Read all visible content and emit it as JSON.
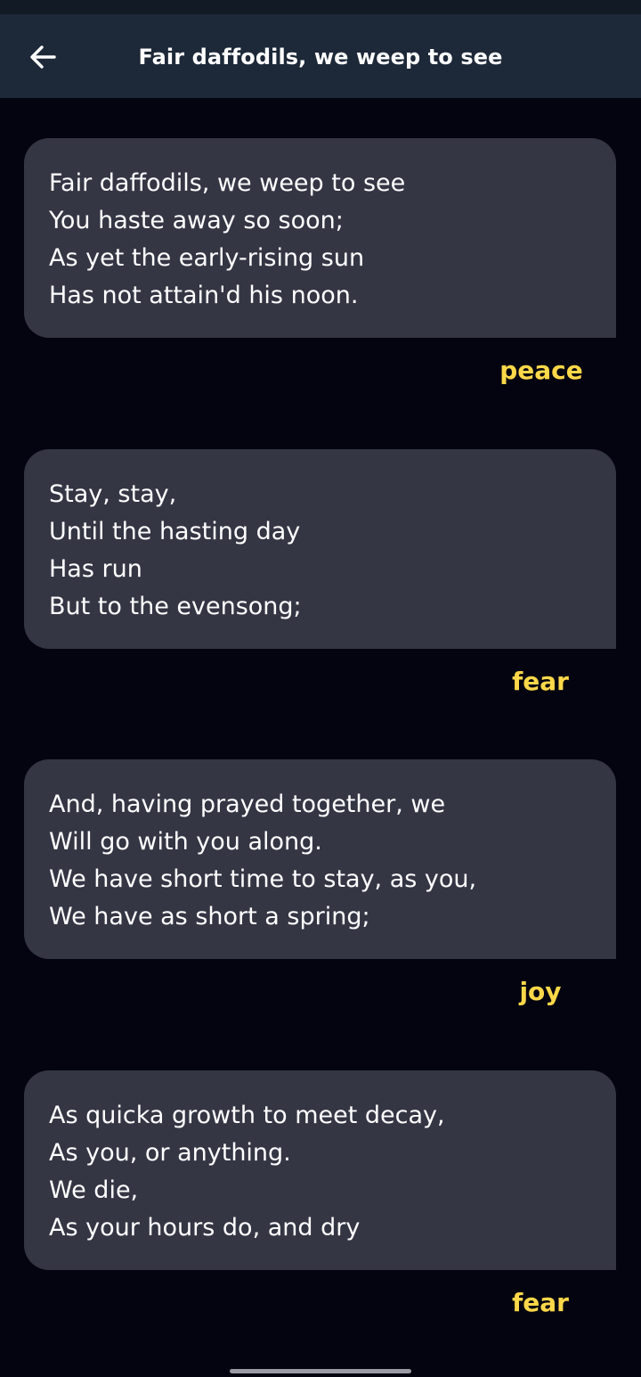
{
  "header": {
    "title": "Fair daffodils, we weep to see",
    "back_icon": "arrow-left-icon"
  },
  "stanzas": [
    {
      "lines": [
        "Fair daffodils, we weep to see",
        "You haste away so soon;",
        "As yet the early-rising sun",
        "Has not attain'd his noon."
      ],
      "emotion": "peace"
    },
    {
      "lines": [
        "Stay, stay,",
        "Until the hasting day",
        "Has run",
        "But to the evensong;"
      ],
      "emotion": "fear"
    },
    {
      "lines": [
        "And, having prayed together, we",
        "Will go with you along.",
        "We have short time to stay, as you,",
        "We have as short a spring;"
      ],
      "emotion": "joy"
    },
    {
      "lines": [
        "As quicka growth to meet decay,",
        "As you, or anything.",
        "We die,",
        "As your hours do, and dry"
      ],
      "emotion": "fear"
    }
  ],
  "colors": {
    "background": "#03040f",
    "app_bar": "#1d2838",
    "card": "#343644",
    "emotion_label": "#ffd84a",
    "text": "#ffffff"
  }
}
